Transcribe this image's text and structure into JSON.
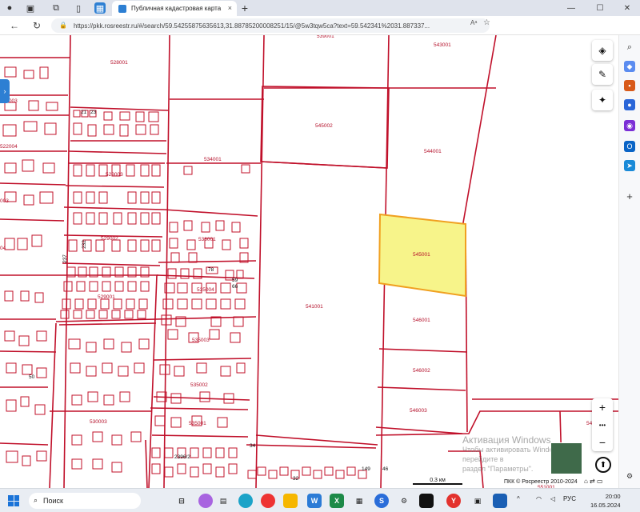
{
  "browser": {
    "tab_title": "Публичная кадастровая карта",
    "url": "https://pkk.rosreestr.ru/#/search/59.54255875635613,31.88785200008251/15/@5w3tqw5ca?text=59.542341%2031.887337...",
    "new_tab": "+",
    "close_tab": "×",
    "window": {
      "minimize": "—",
      "maximize": "☐",
      "close": "✕"
    },
    "nav": {
      "back": "←",
      "refresh": "↻"
    },
    "reader": "Aᵃ",
    "favorite": "☆",
    "lock": "🔒"
  },
  "map": {
    "parcels": [
      {
        "label": "539001"
      },
      {
        "label": "543001"
      },
      {
        "label": "528001"
      },
      {
        "label": "545002"
      },
      {
        "label": "544001"
      },
      {
        "label": "534001"
      },
      {
        "label": "529003"
      },
      {
        "label": "545001",
        "highlighted": true
      },
      {
        "label": "529002"
      },
      {
        "label": "533001"
      },
      {
        "label": "535004"
      },
      {
        "label": "529001"
      },
      {
        "label": "541001"
      },
      {
        "label": "546001"
      },
      {
        "label": "535003"
      },
      {
        "label": "546002"
      },
      {
        "label": "535002"
      },
      {
        "label": "546003"
      },
      {
        "label": "530003"
      },
      {
        "label": "535001"
      },
      {
        "label": "522003"
      },
      {
        "label": "522004"
      },
      {
        "label": "551001"
      },
      {
        "label": "542003"
      }
    ],
    "small_labels": [
      "21",
      "23",
      "78",
      "59",
      "66",
      "50",
      "34",
      "2396/2",
      "32",
      "149",
      "46",
      "232",
      "237",
      "003",
      "04"
    ],
    "highlight_color": "#f7f48a",
    "highlight_border": "#f0a020",
    "boundary_color": "#c0102a",
    "scale_label": "0.3 км",
    "copyright": "ПКК © Росреестр 2010-2024",
    "activation": {
      "title": "Активация Windows",
      "line1": "Чтобы активировать Windows, перейдите в",
      "line2": "раздел \"Параметры\"."
    },
    "tools": {
      "layers": "layers-icon",
      "ruler": "ruler-icon",
      "locate": "target-icon"
    },
    "zoom": {
      "in": "+",
      "dots": "•••",
      "out": "−"
    },
    "side_tab": "›"
  },
  "taskbar": {
    "search_placeholder": "Поиск",
    "lang": "РУС",
    "time": "20:00",
    "date": "16.05.2024"
  }
}
